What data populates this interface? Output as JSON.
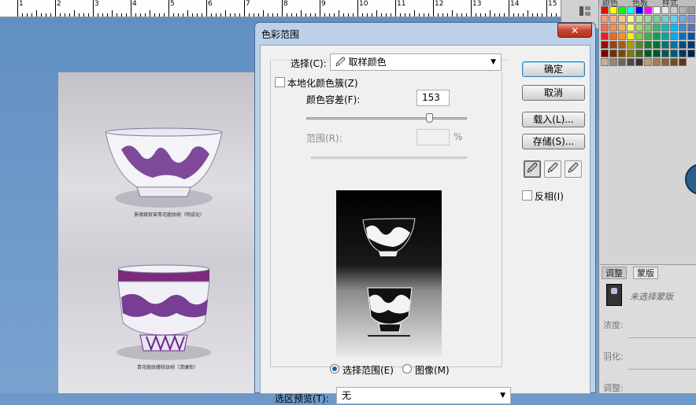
{
  "ruler": {
    "labels": [
      "1",
      "2",
      "3",
      "4",
      "5",
      "6",
      "7",
      "8",
      "9",
      "10",
      "11",
      "12",
      "13",
      "14",
      "15"
    ]
  },
  "document": {
    "caption_top": "景德鎮官窯青花龍紋碗（明成化）",
    "caption_bottom": "青花龍紋纏枝紋碗（清康熙）"
  },
  "swatch_panel": {
    "tabs": [
      "颜色",
      "色板",
      "样式"
    ],
    "colors": [
      "#ff0000",
      "#ffff00",
      "#00ff00",
      "#00ffff",
      "#0000ff",
      "#ff00ff",
      "#ffffff",
      "#e6e6e6",
      "#cccccc",
      "#b3b3b3",
      "#999999",
      "#f7977a",
      "#fbad82",
      "#fdc68c",
      "#fff799",
      "#c4df9b",
      "#a3d39c",
      "#82ca9d",
      "#7bcdc8",
      "#6ecff6",
      "#7ea7d8",
      "#8493ca",
      "#f26c4f",
      "#f68e56",
      "#fbaf5d",
      "#fff468",
      "#acd372",
      "#7cc576",
      "#3bb878",
      "#1abbb4",
      "#00bff3",
      "#438ccb",
      "#5574b9",
      "#ed1c24",
      "#f26522",
      "#f7941d",
      "#fff200",
      "#8dc63f",
      "#39b54a",
      "#00a651",
      "#00a99d",
      "#00aeef",
      "#0072bc",
      "#0054a6",
      "#9e0b0f",
      "#a0410d",
      "#a3620a",
      "#aba000",
      "#598527",
      "#1a7b30",
      "#007236",
      "#00746b",
      "#0076a3",
      "#004b80",
      "#003471",
      "#790000",
      "#7b2e00",
      "#7d4900",
      "#827b00",
      "#406618",
      "#005e20",
      "#005826",
      "#005952",
      "#005b7f",
      "#003663",
      "#002157",
      "#c7b299",
      "#998675",
      "#736357",
      "#534741",
      "#37302d",
      "#c69c6d",
      "#a67c52",
      "#8c6239",
      "#754c24",
      "#603913"
    ]
  },
  "adjust_panel": {
    "tabs": [
      "调整",
      "蒙版"
    ],
    "mask_status": "未选择蒙版",
    "density_label": "浓度:",
    "feather_label": "羽化:",
    "refine_label": "调整:"
  },
  "dialog": {
    "title": "色彩范围",
    "close_glyph": "✕",
    "select_label": "选择(C):",
    "select_value": "取样颜色",
    "localized_label": "本地化颜色簇(Z)",
    "fuzziness_label": "颜色容差(F):",
    "fuzziness_value": "153",
    "range_label": "范围(R):",
    "range_value": "",
    "range_unit": "%",
    "radio_selection": "选择范围(E)",
    "radio_image": "图像(M)",
    "preview_label": "选区预览(T):",
    "preview_value": "无",
    "ok": "确定",
    "cancel": "取消",
    "load": "载入(L)...",
    "save": "存储(S)...",
    "invert": "反相(I)"
  }
}
